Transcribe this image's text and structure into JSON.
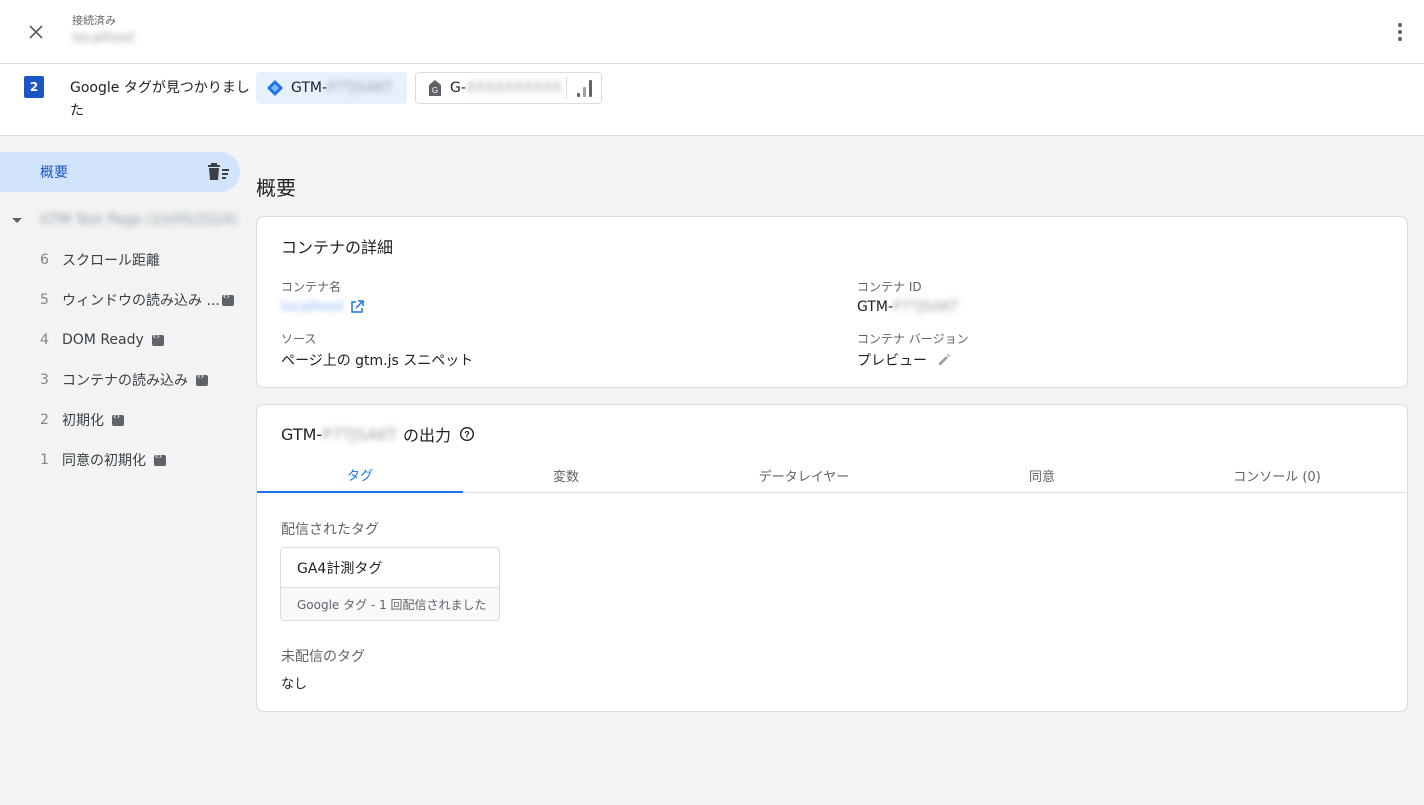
{
  "topbar": {
    "status_label": "接続済み",
    "host": "localhost"
  },
  "tagbar": {
    "count": "2",
    "found_text": "Google タグが見つかりました",
    "gtm_prefix": "GTM-",
    "gtm_id": "P7TJSAKT",
    "ga_prefix": "G-",
    "ga_id": "XXXXXXXXXX"
  },
  "sidebar": {
    "summary_label": "概要",
    "page_label": "GTM Test Page (10/05/2024)",
    "events": [
      {
        "num": "6",
        "label": "スクロール距離",
        "badge": false
      },
      {
        "num": "5",
        "label": "ウィンドウの読み込み ...",
        "badge": true
      },
      {
        "num": "4",
        "label": "DOM Ready",
        "badge": true
      },
      {
        "num": "3",
        "label": "コンテナの読み込み",
        "badge": true
      },
      {
        "num": "2",
        "label": "初期化",
        "badge": true
      },
      {
        "num": "1",
        "label": "同意の初期化",
        "badge": true
      }
    ]
  },
  "main": {
    "title": "概要",
    "container": {
      "heading": "コンテナの詳細",
      "name_label": "コンテナ名",
      "name_value": "localhost",
      "id_label": "コンテナ ID",
      "id_prefix": "GTM-",
      "id_value": "P7TJSAKT",
      "source_label": "ソース",
      "source_value": "ページ上の gtm.js スニペット",
      "version_label": "コンテナ バージョン",
      "version_value": "プレビュー"
    },
    "output": {
      "heading_prefix": "GTM-",
      "heading_id": "P7TJSAKT",
      "heading_suffix": "の出力",
      "tabs": [
        "タグ",
        "変数",
        "データレイヤー",
        "同意",
        "コンソール (0)"
      ],
      "fired_label": "配信されたタグ",
      "fired_tag_name": "GA4計測タグ",
      "fired_tag_sub": "Google タグ - 1 回配信されました",
      "not_fired_label": "未配信のタグ",
      "not_fired_value": "なし"
    }
  },
  "colors": {
    "accent": "#1a73e8",
    "active_bg": "#d2e3fc",
    "badge": "#1a56c5"
  }
}
